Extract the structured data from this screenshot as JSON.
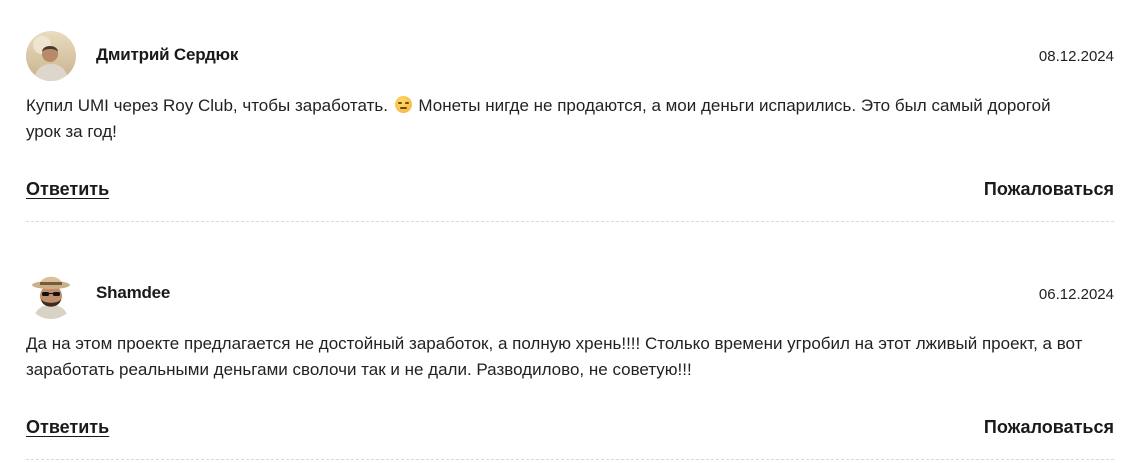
{
  "comments": [
    {
      "author": "Дмитрий Сердюк",
      "date": "08.12.2024",
      "text_before_emoji": "Купил UMI через Roy Club, чтобы заработать. ",
      "emoji": "expressionless-face-icon",
      "text_after_emoji": " Монеты нигде не продаются, а мои деньги испарились. Это был самый дорогой урок за год!",
      "reply_label": "Ответить",
      "report_label": "Пожаловаться"
    },
    {
      "author": "Shamdee",
      "date": "06.12.2024",
      "text": "Да на этом проекте предлагается не достойный заработок, а полную хрень!!!! Столько времени угробил на этот лживый проект, а вот заработать реальными деньгами сволочи так и не дали. Разводилово, не советую!!!",
      "reply_label": "Ответить",
      "report_label": "Пожаловаться"
    }
  ]
}
